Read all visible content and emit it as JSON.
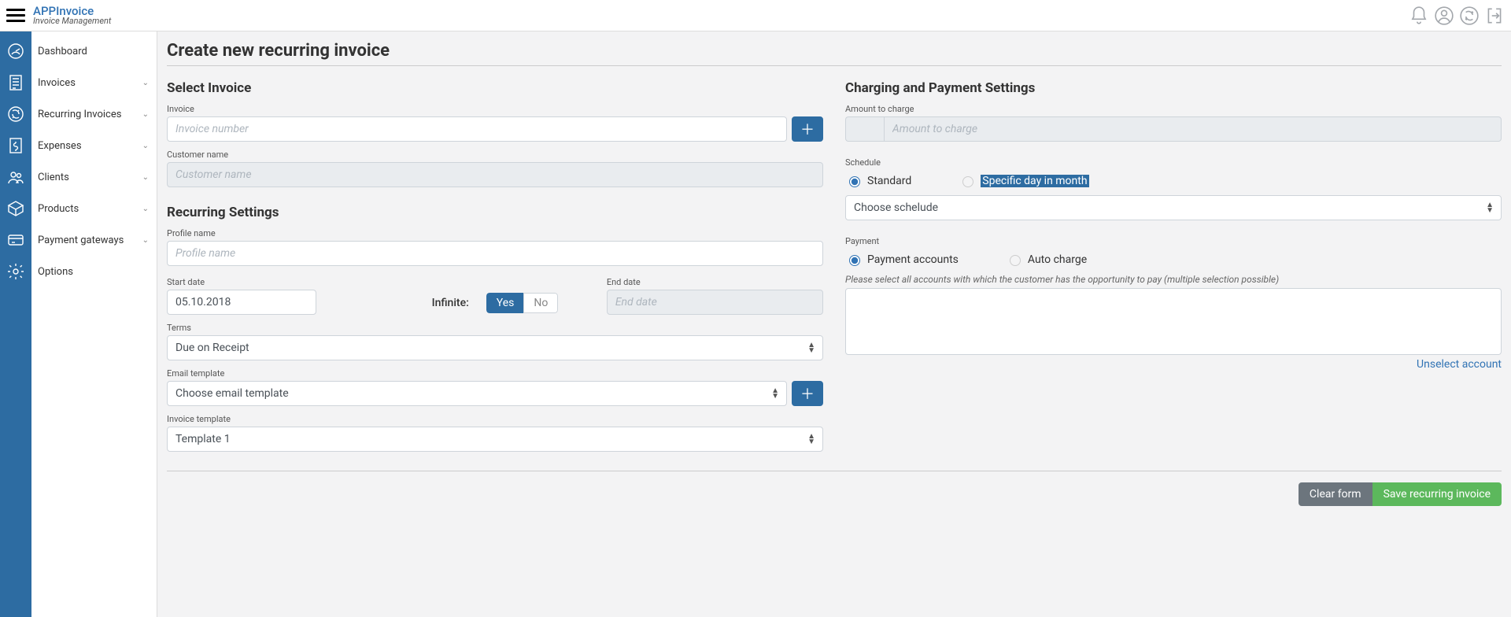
{
  "header": {
    "brand_title": "APPInvoice",
    "brand_sub": "Invoice Management"
  },
  "sidebar": {
    "items": [
      {
        "label": "Dashboard",
        "expandable": false
      },
      {
        "label": "Invoices",
        "expandable": true
      },
      {
        "label": "Recurring Invoices",
        "expandable": true
      },
      {
        "label": "Expenses",
        "expandable": true
      },
      {
        "label": "Clients",
        "expandable": true
      },
      {
        "label": "Products",
        "expandable": true
      },
      {
        "label": "Payment gateways",
        "expandable": true
      },
      {
        "label": "Options",
        "expandable": false
      }
    ]
  },
  "page": {
    "title": "Create new recurring invoice"
  },
  "left": {
    "select_invoice": {
      "title": "Select Invoice",
      "invoice_label": "Invoice",
      "invoice_placeholder": "Invoice number",
      "customer_label": "Customer name",
      "customer_placeholder": "Customer name"
    },
    "recurring": {
      "title": "Recurring Settings",
      "profile_label": "Profile name",
      "profile_placeholder": "Profile name",
      "start_label": "Start date",
      "start_value": "05.10.2018",
      "infinite_label": "Infinite:",
      "yes": "Yes",
      "no": "No",
      "end_label": "End date",
      "end_placeholder": "End date",
      "terms_label": "Terms",
      "terms_value": "Due on Receipt",
      "email_label": "Email template",
      "email_value": "Choose email template",
      "invoice_tpl_label": "Invoice template",
      "invoice_tpl_value": "Template 1"
    }
  },
  "right": {
    "title": "Charging and Payment Settings",
    "amount_label": "Amount to charge",
    "amount_placeholder": "Amount to charge",
    "schedule_label": "Schedule",
    "schedule_standard": "Standard",
    "schedule_specific": "Specific day in month",
    "schedule_select": "Choose schelude",
    "payment_label": "Payment",
    "payment_accounts": "Payment accounts",
    "auto_charge": "Auto charge",
    "hint": "Please select all accounts with which the customer has the opportunity to pay (multiple selection possible)",
    "unselect": "Unselect account"
  },
  "footer": {
    "clear": "Clear form",
    "save": "Save recurring invoice"
  }
}
